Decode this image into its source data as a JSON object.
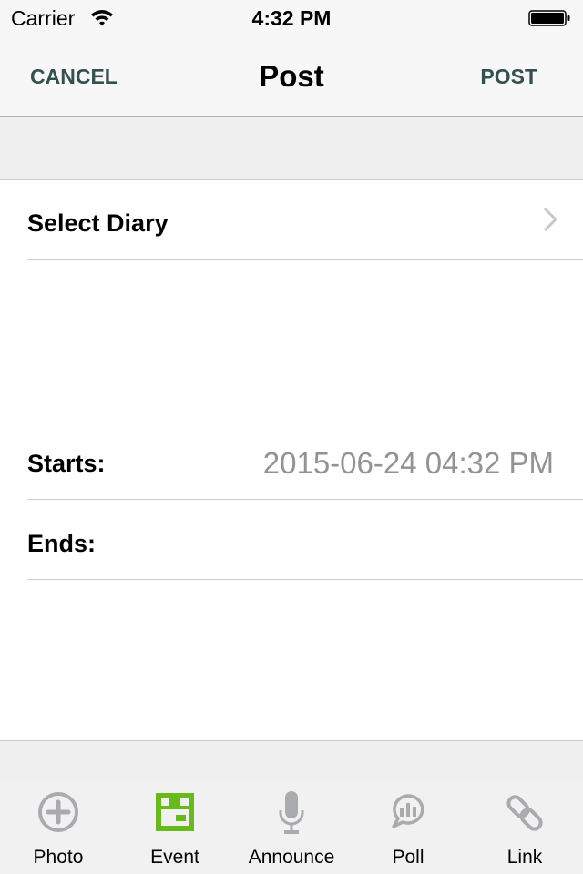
{
  "status_bar": {
    "carrier": "Carrier",
    "time": "4:32 PM",
    "wifi_icon": "wifi-icon",
    "battery_icon": "battery-full-icon"
  },
  "nav": {
    "cancel_label": "CANCEL",
    "title": "Post",
    "post_label": "POST",
    "accent_color": "#34504f"
  },
  "form": {
    "select_diary_label": "Select Diary",
    "select_diary_icon": "chevron-right-icon",
    "starts_label": "Starts:",
    "starts_value": "2015-06-24 04:32 PM",
    "ends_label": "Ends:",
    "ends_value": ""
  },
  "tabbar": {
    "active_color": "#66bb1b",
    "inactive_color": "#a9abae",
    "items": [
      {
        "label": "Photo",
        "icon": "plus-circle-icon",
        "active": false
      },
      {
        "label": "Event",
        "icon": "calendar-icon",
        "active": true
      },
      {
        "label": "Announce",
        "icon": "microphone-icon",
        "active": false
      },
      {
        "label": "Poll",
        "icon": "poll-chat-icon",
        "active": false
      },
      {
        "label": "Link",
        "icon": "link-icon",
        "active": false
      }
    ]
  }
}
